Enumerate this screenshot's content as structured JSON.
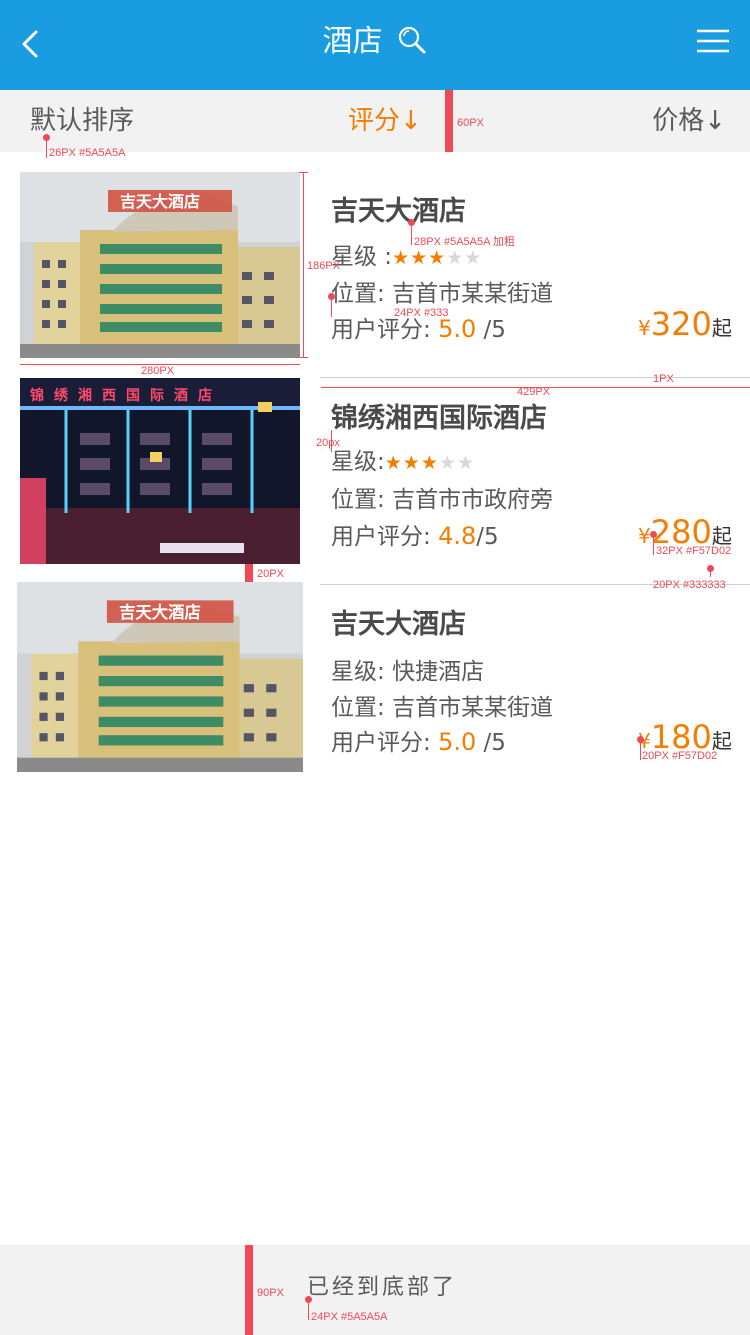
{
  "header": {
    "title": "酒店",
    "back_icon": "back-arrow-icon",
    "search_icon": "search-icon",
    "menu_icon": "menu-icon",
    "background": "#1a9ce0"
  },
  "sort_bar": {
    "default_label": "默认排序",
    "rating_label": "评分↓",
    "price_label": "价格↓",
    "active_color": "#f57d02"
  },
  "hotels": [
    {
      "name": "吉天大酒店",
      "star_label": "星级 :",
      "stars": 3,
      "max_stars": 5,
      "location_label": "位置:",
      "location": "吉首市某某街道",
      "rating_label": "用户评分:",
      "rating": "5.0",
      "rating_max": "/5",
      "currency": "¥",
      "price": "320",
      "price_suffix": "起"
    },
    {
      "name": "锦绣湘西国际酒店",
      "star_label": "星级:",
      "stars": 3,
      "max_stars": 5,
      "location_label": "位置:",
      "location": "吉首市市政府旁",
      "rating_label": "用户评分:",
      "rating": "4.8",
      "rating_max": "/5",
      "currency": "¥",
      "price": "280",
      "price_suffix": "起",
      "photo_sign": "锦绣湘西国际酒店"
    },
    {
      "name": "吉天大酒店",
      "star_label": "星级:",
      "star_text": "快捷酒店",
      "location_label": "位置:",
      "location": "吉首市某某街道",
      "rating_label": "用户评分:",
      "rating": "5.0",
      "rating_max": "/5",
      "currency": "¥",
      "price": "180",
      "price_suffix": "起"
    }
  ],
  "hotel_photo_sign": "吉天大酒店",
  "footer": {
    "text": "已经到底部了"
  },
  "annotations": {
    "sort_font": "26PX #5A5A5A",
    "sortbar_height": "60PX",
    "name_font": "28PX #5A5A5A 加粗",
    "photo_height": "186PX",
    "info_font": "24PX #333",
    "photo_width": "280PX",
    "right_width": "429PX",
    "divider_height": "1PX",
    "name_gap": "20px",
    "price_font": "32PX #F57D02",
    "suffix_font": "20PX #333333",
    "card_gap": "20PX",
    "currency_font": "20PX #F57D02",
    "footer_height": "90PX",
    "footer_font": "24PX #5A5A5A"
  }
}
